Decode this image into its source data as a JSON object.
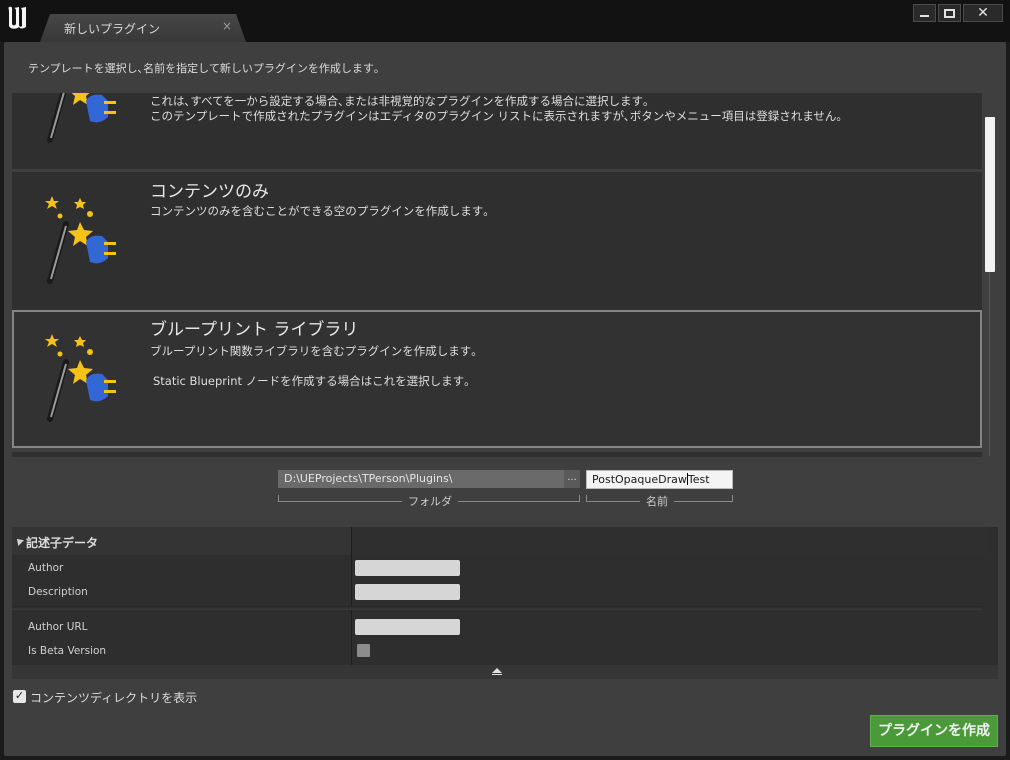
{
  "window": {
    "tab_label": "新しいプラグイン",
    "tab_close": "×"
  },
  "instruction": "テンプレートを選択し､名前を指定して新しいプラグインを作成します｡",
  "templates": [
    {
      "title": "",
      "desc_lines": [
        "これは､すべてを一から設定する場合､または非視覚的なプラグインを作成する場合に選択します｡",
        "このテンプレートで作成されたプラグインはエディタのプラグイン リストに表示されますが､ボタンやメニュー項目は登録されません｡"
      ]
    },
    {
      "title": "コンテンツのみ",
      "desc_lines": [
        "コンテンツのみを含むことができる空のプラグインを作成します｡"
      ]
    },
    {
      "title": "ブループリント ライブラリ",
      "desc_lines": [
        "ブループリント関数ライブラリを含むプラグインを作成します｡",
        "Static Blueprint ノードを作成する場合はこれを選択します｡"
      ],
      "selected": true
    }
  ],
  "path": {
    "folder_value": "D:\\UEProjects\\TPerson\\Plugins\\",
    "browse_label": "...",
    "folder_label": "フォルダ",
    "name_before_caret": "PostOpaqueDraw",
    "name_after_caret": "Test",
    "name_label": "名前"
  },
  "details": {
    "title": "記述子データ",
    "properties": [
      "Author",
      "Description",
      "Author URL",
      "Is Beta Version"
    ]
  },
  "show_content_dir": {
    "label": "コンテンツディレクトリを表示",
    "checked": true
  },
  "create_button": "プラグインを作成",
  "colors": {
    "accent_green": "#4a9a3a",
    "panel": "#3f3f3f",
    "card": "#2f2f2f"
  }
}
